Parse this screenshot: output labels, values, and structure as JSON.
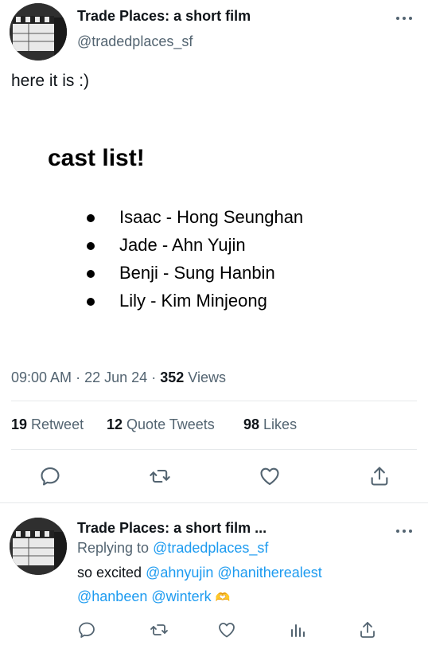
{
  "tweet": {
    "author_name": "Trade Places: a short film",
    "author_handle": "@tradedplaces_sf",
    "text": "here it is :)",
    "card": {
      "title": "cast list!",
      "cast": [
        "Isaac - Hong Seunghan",
        "Jade - Ahn Yujin",
        "Benji - Sung Hanbin",
        "Lily - Kim Minjeong"
      ]
    },
    "time": "09:00 AM",
    "date": "22 Jun 24",
    "views_count": "352",
    "views_label": "Views",
    "stats": {
      "retweets_count": "19",
      "retweets_label": "Retweet",
      "quotes_count": "12",
      "quotes_label": "Quote Tweets",
      "likes_count": "98",
      "likes_label": "Likes"
    }
  },
  "reply": {
    "author_name": "Trade Places: a short film ...",
    "replying_to_label": "Replying to",
    "replying_to_handle": "@tradedplaces_sf",
    "text_lead": "so excited",
    "mention_1": "@ahnyujin",
    "mention_2": "@hanitherealest",
    "mention_3": "@hanbeen",
    "mention_4": "@winterk",
    "emoji": "🫶"
  },
  "icons": {
    "more": "more-dots-icon",
    "reply": "reply-icon",
    "retweet": "retweet-icon",
    "like": "heart-icon",
    "share": "share-icon",
    "analytics": "analytics-icon"
  },
  "colors": {
    "text": "#0f1419",
    "secondary": "#536471",
    "link": "#1d9bf0",
    "divider": "#e6e9eb"
  }
}
